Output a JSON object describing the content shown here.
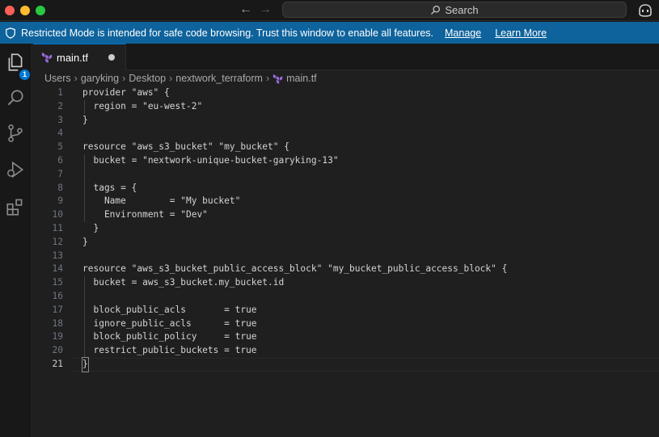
{
  "titlebar": {
    "search_label": "Search",
    "back_icon": "arrow-left-icon",
    "forward_icon": "arrow-right-icon"
  },
  "banner": {
    "message": "Restricted Mode is intended for safe code browsing. Trust this window to enable all features.",
    "manage_label": "Manage",
    "learn_more_label": "Learn More",
    "color": "#0e639c"
  },
  "activity": {
    "explorer_badge": "1"
  },
  "tab": {
    "filename": "main.tf",
    "modified": true
  },
  "breadcrumb": [
    "Users",
    "garyking",
    "Desktop",
    "nextwork_terraform",
    "main.tf"
  ],
  "editor": {
    "active_line": 21,
    "lines": [
      "provider \"aws\" {",
      "  region = \"eu-west-2\"",
      "}",
      "",
      "resource \"aws_s3_bucket\" \"my_bucket\" {",
      "  bucket = \"nextwork-unique-bucket-garyking-13\"",
      "",
      "  tags = {",
      "    Name        = \"My bucket\"",
      "    Environment = \"Dev\"",
      "  }",
      "}",
      "",
      "resource \"aws_s3_bucket_public_access_block\" \"my_bucket_public_access_block\" {",
      "  bucket = aws_s3_bucket.my_bucket.id",
      "",
      "  block_public_acls       = true",
      "  ignore_public_acls      = true",
      "  block_public_policy     = true",
      "  restrict_public_buckets = true",
      "}"
    ]
  }
}
